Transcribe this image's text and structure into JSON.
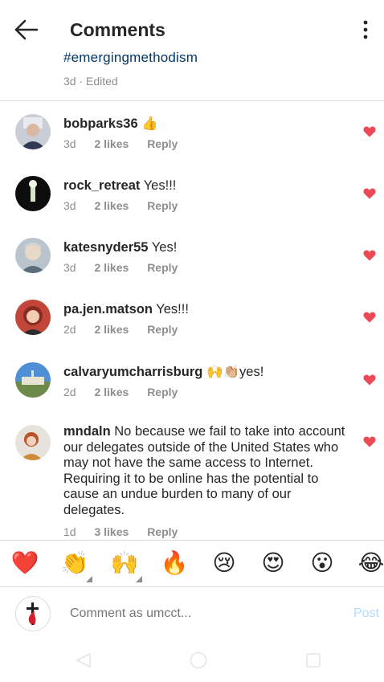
{
  "header": {
    "title": "Comments"
  },
  "caption": {
    "hashtag": "#emergingmethodism",
    "meta": "3d · Edited"
  },
  "comments": [
    {
      "username": "bobparks36",
      "text": "👍",
      "age": "3d",
      "likes": "2 likes",
      "reply": "Reply",
      "heart_color": "#ed4956"
    },
    {
      "username": "rock_retreat",
      "text": "Yes!!!",
      "age": "3d",
      "likes": "2 likes",
      "reply": "Reply",
      "heart_color": "#ed4956"
    },
    {
      "username": "katesnyder55",
      "text": "Yes!",
      "age": "3d",
      "likes": "2 likes",
      "reply": "Reply",
      "heart_color": "#ed4956"
    },
    {
      "username": "pa.jen.matson",
      "text": "Yes!!!",
      "age": "2d",
      "likes": "2 likes",
      "reply": "Reply",
      "heart_color": "#ed4956"
    },
    {
      "username": "calvaryumcharrisburg",
      "text": "🙌👏🏼yes!",
      "age": "2d",
      "likes": "2 likes",
      "reply": "Reply",
      "heart_color": "#ed4956"
    },
    {
      "username": "mndaln",
      "text": "No because we fail to take into account our delegates outside of the United States who may not have the same access to Internet. Requiring it to be online has the potential to cause an undue burden to many of our delegates.",
      "age": "1d",
      "likes": "3 likes",
      "reply": "Reply",
      "heart_color": "#ed4956"
    }
  ],
  "emoji_bar": [
    "❤️",
    "👏",
    "🙌",
    "🔥",
    "😢",
    "😍",
    "😮",
    "😂"
  ],
  "composer": {
    "placeholder": "Comment as umcct...",
    "post_label": "Post"
  },
  "colors": {
    "accent": "#0095f6",
    "post_disabled": "#b3dbff",
    "heart": "#ed4956",
    "hashtag": "#00376b"
  },
  "icons": {
    "back": "arrow-left-icon",
    "more": "vertical-ellipsis-icon",
    "heart": "heart-icon",
    "nav_back": "triangle-back-icon",
    "nav_home": "circle-home-icon",
    "nav_recents": "square-recents-icon"
  }
}
